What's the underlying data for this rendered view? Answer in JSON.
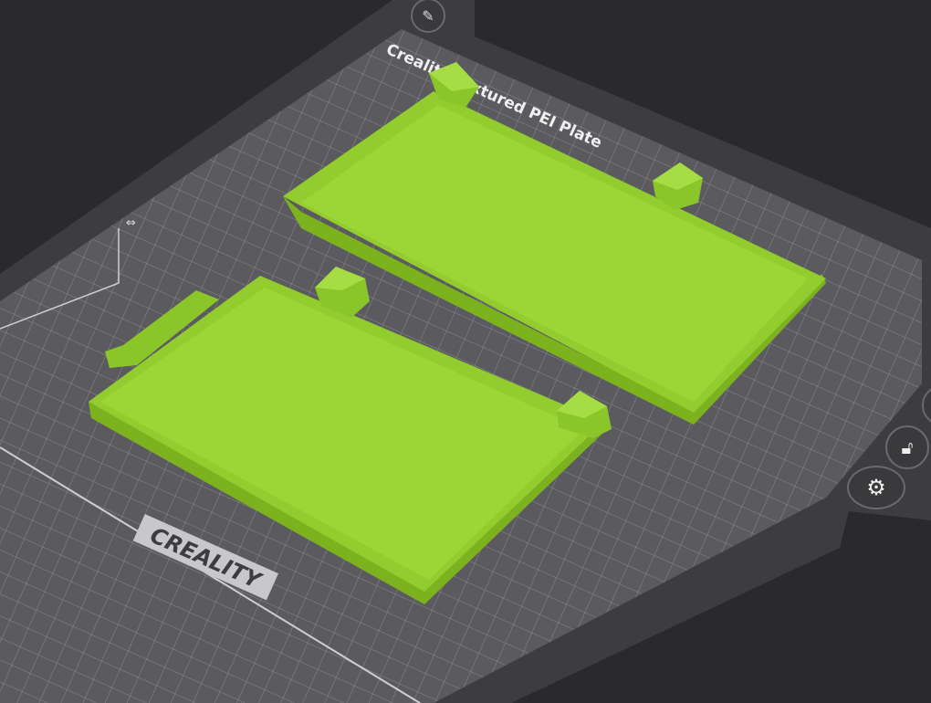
{
  "viewport": {
    "plate_label": "Creality Textured PEI Plate",
    "plate_logo": "CREALITY"
  },
  "colors": {
    "background": "#2a2a2c",
    "plate_frame": "#3d3d40",
    "plate_grid": "#5b5b5f",
    "model_top": "#9cd636",
    "model_side": "#7db21f"
  },
  "plate_buttons": [
    {
      "icon": "edit-icon"
    },
    {
      "icon": "lock-icon"
    },
    {
      "icon": "gear-icon"
    }
  ]
}
